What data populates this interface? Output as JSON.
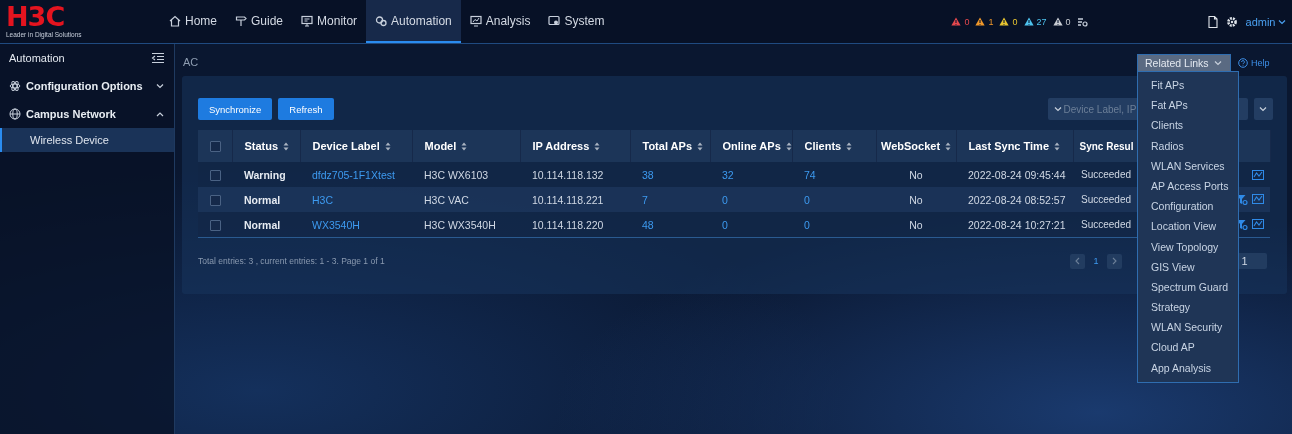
{
  "header": {
    "logo": "H3C",
    "tagline": "Leader in Digital Solutions",
    "nav": [
      {
        "label": "Home",
        "selected": false
      },
      {
        "label": "Guide",
        "selected": false
      },
      {
        "label": "Monitor",
        "selected": false
      },
      {
        "label": "Automation",
        "selected": true
      },
      {
        "label": "Analysis",
        "selected": false
      },
      {
        "label": "System",
        "selected": false
      }
    ],
    "alarms": [
      {
        "count": "0",
        "color": "#e5484d"
      },
      {
        "count": "1",
        "color": "#f0982a"
      },
      {
        "count": "0",
        "color": "#e8c530"
      },
      {
        "count": "27",
        "color": "#4ec3ee"
      },
      {
        "count": "0",
        "color": "#c8ccd2"
      }
    ],
    "user": "admin"
  },
  "sidebar": {
    "title": "Automation",
    "items": [
      {
        "label": "Configuration Options",
        "expanded": false
      },
      {
        "label": "Campus Network",
        "expanded": true,
        "children": [
          {
            "label": "Wireless Device",
            "selected": true
          }
        ]
      }
    ]
  },
  "breadcrumb": "AC",
  "related_links": {
    "label": "Related Links",
    "expanded": true,
    "items": [
      "Fit APs",
      "Fat APs",
      "Clients",
      "Radios",
      "WLAN Services",
      "AP Access Ports",
      "Configuration",
      "Location View",
      "View Topology",
      "GIS View",
      "Spectrum Guard",
      "Strategy",
      "WLAN Security",
      "Cloud AP",
      "App Analysis"
    ]
  },
  "help": "Help",
  "toolbar": {
    "buttons": [
      "Synchronize",
      "Refresh"
    ],
    "search": {
      "placeholder": "Device Label, IP"
    }
  },
  "table": {
    "select_all": {
      "checked": false
    },
    "columns": [
      {
        "label": "Status",
        "kind": "bold"
      },
      {
        "label": "Device Label",
        "kind": "link"
      },
      {
        "label": "Model",
        "kind": "text"
      },
      {
        "label": "IP Address",
        "kind": "text"
      },
      {
        "label": "Total APs",
        "kind": "link"
      },
      {
        "label": "Online APs",
        "kind": "link"
      },
      {
        "label": "Clients",
        "kind": "link"
      },
      {
        "label": "WebSocket",
        "kind": "center"
      },
      {
        "label": "Last Sync Time",
        "kind": "text"
      },
      {
        "label": "Sync Resul",
        "kind": "clip"
      }
    ],
    "rows": [
      {
        "checked": false,
        "cells": [
          "Warning",
          "dfdz705-1F1Xtest",
          "H3C WX6103",
          "10.114.118.132",
          "38",
          "32",
          "74",
          "No",
          "2022-08-24 09:45:44",
          "Succeeded"
        ],
        "actions": [
          {
            "kind": "chart"
          }
        ]
      },
      {
        "checked": false,
        "cells": [
          "Normal",
          "H3C",
          "H3C VAC",
          "10.114.118.221",
          "7",
          "0",
          "0",
          "No",
          "2022-08-24 08:52:57",
          "Succeeded"
        ],
        "actions": [
          {
            "kind": "filter"
          },
          {
            "kind": "chart"
          }
        ]
      },
      {
        "checked": false,
        "cells": [
          "Normal",
          "WX3540H",
          "H3C WX3540H",
          "10.114.118.220",
          "48",
          "0",
          "0",
          "No",
          "2022-08-24 10:27:21",
          "Succeeded"
        ],
        "actions": [
          {
            "kind": "filter"
          },
          {
            "kind": "chart"
          }
        ]
      }
    ]
  },
  "footer": {
    "summary": "Total entries: 3 , current entries: 1 - 3. Page 1 of 1",
    "pages": [
      {
        "label": "1",
        "selected": true
      }
    ],
    "jump": "1"
  }
}
